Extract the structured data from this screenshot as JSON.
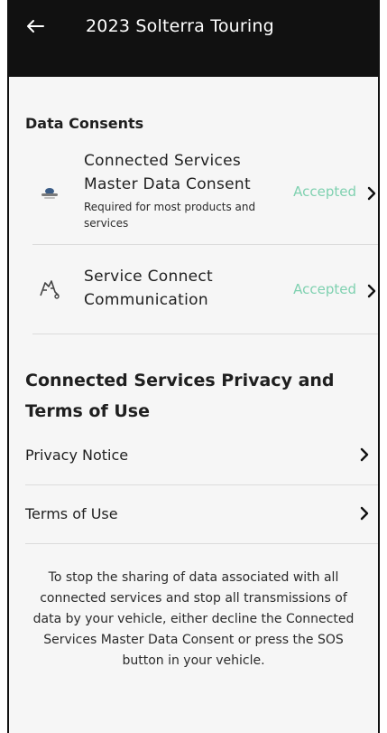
{
  "header": {
    "title": "2023 Solterra Touring",
    "back_icon": "back-arrow-icon"
  },
  "data_consents": {
    "section_title": "Data Consents",
    "items": [
      {
        "title": "Connected Services Master Data Consent",
        "subtitle": "Required for most products and services",
        "status": "Accepted",
        "icon": "connected-services-icon"
      },
      {
        "title": "Service Connect Communication",
        "subtitle": "",
        "status": "Accepted",
        "icon": "service-connect-icon"
      }
    ]
  },
  "privacy": {
    "heading": "Connected Services Privacy and Terms of Use",
    "links": [
      {
        "label": "Privacy Notice"
      },
      {
        "label": "Terms of Use"
      }
    ],
    "footer_note": "To stop the sharing of data associated with all connected services and stop all transmissions of data by your vehicle, either decline the Connected Services Master Data Consent or press the SOS button in your vehicle."
  },
  "colors": {
    "header_bg": "#111111",
    "status_accepted": "#7fd1b0",
    "page_bg": "#f6f6f6"
  }
}
